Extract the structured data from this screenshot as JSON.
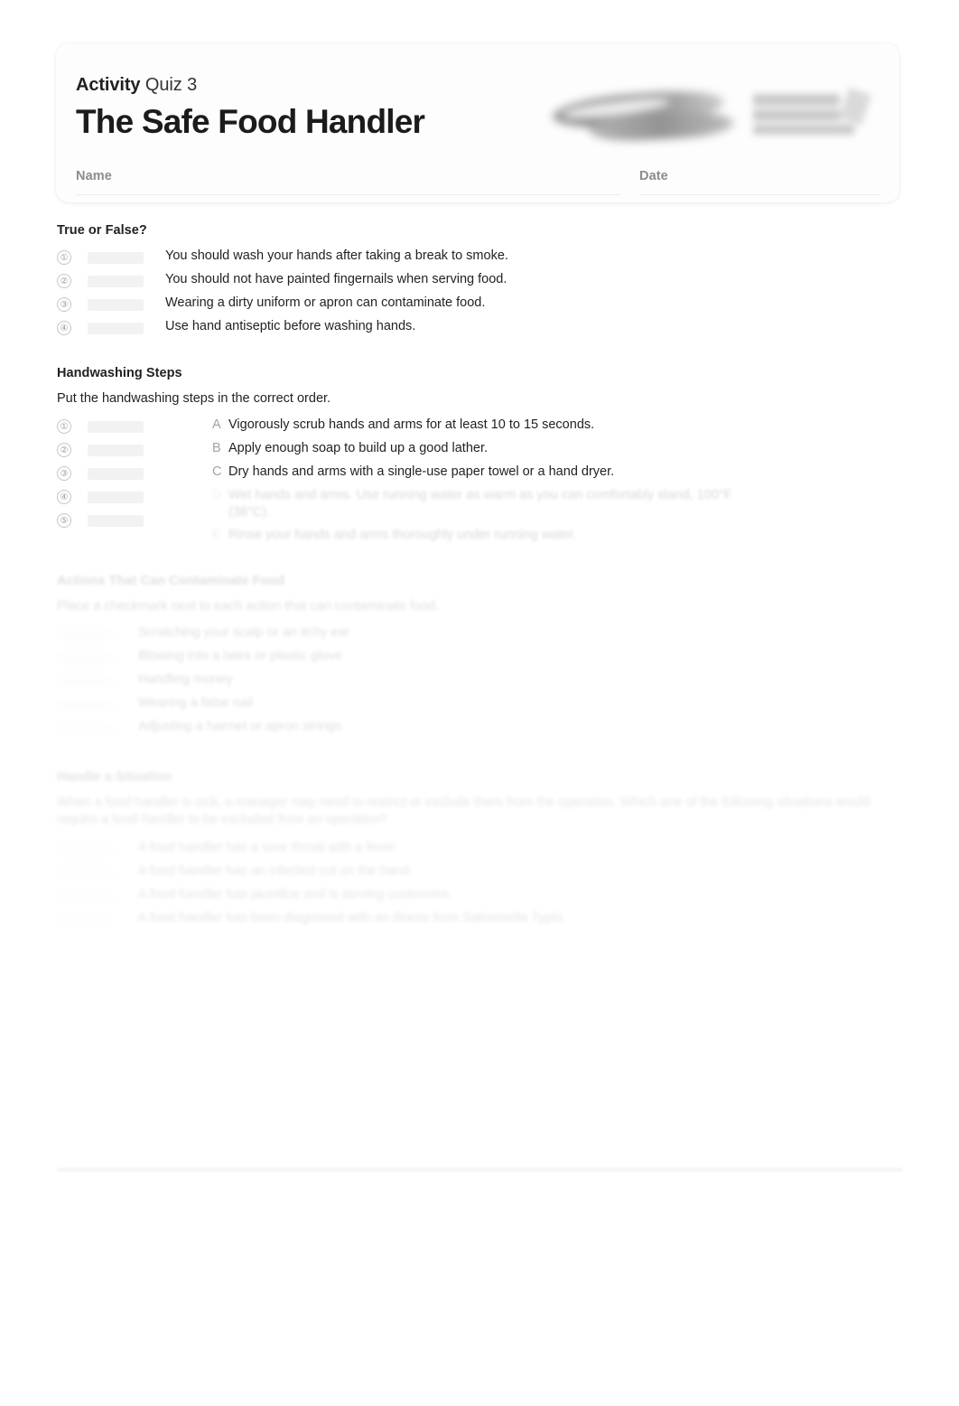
{
  "header": {
    "kicker_strong": "Activity",
    "kicker_light": "Quiz 3",
    "title": "The Safe Food Handler",
    "name_label": "Name",
    "date_label": "Date",
    "logo_alt": "publisher-logo-redacted"
  },
  "sections": [
    {
      "id": "true-or-false",
      "title": "True or False?",
      "items": [
        {
          "num": "①",
          "text": "You should wash your hands after taking a break to smoke."
        },
        {
          "num": "②",
          "text": "You should not have painted fingernails when serving food."
        },
        {
          "num": "③",
          "text": "Wearing a dirty uniform or apron can contaminate food."
        },
        {
          "num": "④",
          "text": "Use hand antiseptic before washing hands."
        }
      ]
    },
    {
      "id": "handwashing-steps",
      "title": "Handwashing Steps",
      "instruction": "Put the handwashing steps in the correct order.",
      "numbers": [
        "①",
        "②",
        "③",
        "④",
        "⑤"
      ],
      "options": [
        {
          "letter": "A",
          "text": "Vigorously scrub hands and arms for at least 10 to 15 seconds.",
          "legible": true
        },
        {
          "letter": "B",
          "text": "Apply enough soap to build up a good lather.",
          "legible": true
        },
        {
          "letter": "C",
          "text": "Dry hands and arms with a single-use paper towel or a hand dryer.",
          "legible": true
        },
        {
          "letter": "D",
          "text": "Wet hands and arms. Use running water as warm as you can comfortably stand, 100°F (38°C).",
          "legible": false
        },
        {
          "letter": "E",
          "text": "Rinse your hands and arms thoroughly under running water.",
          "legible": false
        }
      ]
    },
    {
      "id": "actions-that-can-contaminate-food",
      "title": "Actions That Can Contaminate Food",
      "instruction": "Place a checkmark next to each action that can contaminate food.",
      "items": [
        {
          "text": "Scratching your scalp or an itchy ear",
          "legible": false
        },
        {
          "text": "Blowing into a latex or plastic glove",
          "legible": false
        },
        {
          "text": "Handling money",
          "legible": false
        },
        {
          "text": "Wearing a false nail",
          "legible": false
        },
        {
          "text": "Adjusting a hairnet or apron strings",
          "legible": false
        }
      ]
    },
    {
      "id": "handle-a-situation",
      "title": "Handle a Situation",
      "instruction": "When a food handler is sick, a manager may need to restrict or exclude them from the operation. Which one of the following situations would require a food handler to be excluded from an operation?",
      "items": [
        {
          "text": "A food handler has a sore throat with a fever.",
          "legible": false
        },
        {
          "text": "A food handler has an infected cut on the hand.",
          "legible": false
        },
        {
          "text": "A food handler has jaundice and is serving customers.",
          "legible": false
        },
        {
          "text": "A food handler has been diagnosed with an illness from Salmonella Typhi.",
          "legible": false
        }
      ]
    }
  ]
}
